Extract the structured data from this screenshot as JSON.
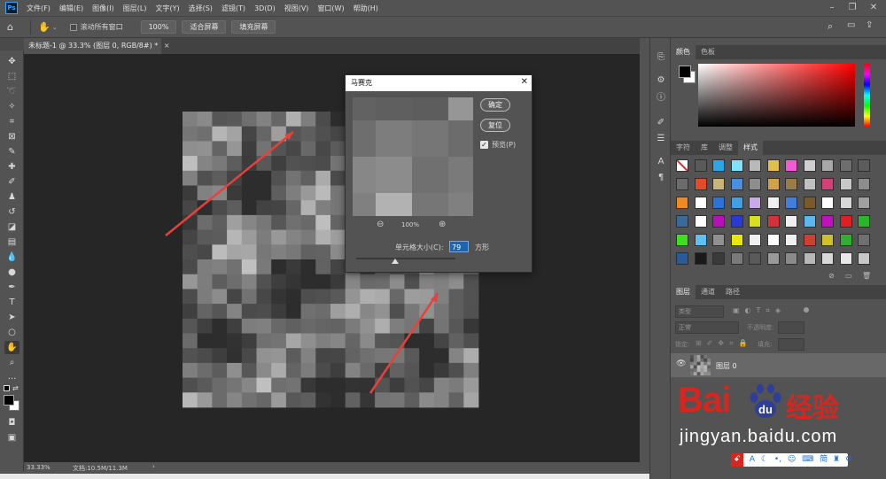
{
  "app": {
    "logo": "Ps",
    "menu": [
      "文件(F)",
      "编辑(E)",
      "图像(I)",
      "图层(L)",
      "文字(Y)",
      "选择(S)",
      "滤镜(T)",
      "3D(D)",
      "视图(V)",
      "窗口(W)",
      "帮助(H)"
    ]
  },
  "options_bar": {
    "scroll_all_label": "滚动所有窗口",
    "zoom_value": "100%",
    "fit_screen_label": "适合屏幕",
    "fill_screen_label": "填充屏幕"
  },
  "document": {
    "tab_title": "未标题-1 @ 33.3% (图层 0, RGB/8#) *",
    "close_glyph": "×"
  },
  "status_bar": {
    "zoom": "33.33%",
    "doc_info": "文档:10.5M/11.3M",
    "arrow": "›"
  },
  "mosaic_dialog": {
    "title": "马赛克",
    "ok_label": "确定",
    "reset_label": "复位",
    "preview_label": "预览(P)",
    "preview_checked": true,
    "zoom": "100%",
    "cell_size_label": "单元格大小(C):",
    "cell_size_value": "79",
    "unit_label": "方形",
    "slider_fraction": 0.39
  },
  "panels": {
    "color_tabs": [
      "颜色",
      "色板"
    ],
    "style_tabs": [
      "字符",
      "库",
      "调整",
      "样式"
    ],
    "layer_tabs": [
      "图层",
      "通道",
      "路径"
    ],
    "layer_filter_label": "类型",
    "blend_mode": "正常",
    "opacity_label": "不透明度:",
    "lock_label": "锁定:",
    "fill_label": "填充:",
    "layer_name": "图层 0"
  },
  "watermark": {
    "brand_left": "Bai",
    "brand_right": "经验",
    "url": "jingyan.baidu.com",
    "toolbar_text": "简"
  },
  "colors": {
    "accent_blue": "#31a8ff",
    "arrow_red": "#e8413a",
    "watermark_red": "#d8261f",
    "watermark_blue": "#2f3f99"
  }
}
